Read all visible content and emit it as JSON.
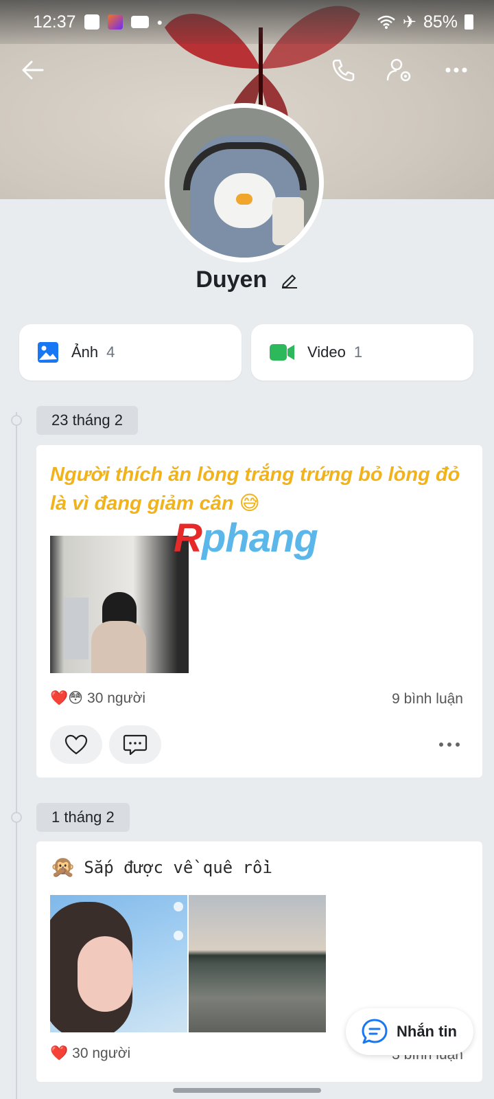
{
  "status_bar": {
    "time": "12:37",
    "battery": "85%",
    "icons": [
      "shopee-icon",
      "lazada-icon",
      "youtube-icon",
      "dot-icon",
      "wifi-icon",
      "airplane-icon",
      "battery-icon"
    ]
  },
  "header": {
    "icons": [
      "back-arrow-icon",
      "phone-call-icon",
      "profile-settings-icon",
      "more-icon"
    ]
  },
  "profile": {
    "name": "Duyen"
  },
  "media": {
    "photos_label": "Ảnh",
    "photos_count": "4",
    "videos_label": "Video",
    "videos_count": "1"
  },
  "posts": [
    {
      "date": "23 tháng 2",
      "text": "Người thích ăn lòng trắng trứng bỏ lòng đỏ là vì đang giảm cân 😅",
      "reaction_emojis": "❤️😳",
      "reactions_count": "30 người",
      "comments": "9 bình luận"
    },
    {
      "date": "1 tháng 2",
      "emoji": "🙊",
      "text": "Sắp được về quê rồi",
      "reaction_emojis": "❤️",
      "reactions_count": "30 người",
      "comments": "3 bình luận"
    }
  ],
  "watermark": {
    "first": "R",
    "rest": "phang"
  },
  "fab": {
    "label": "Nhắn tin"
  },
  "colors": {
    "accent_blue": "#1877f2",
    "video_green": "#2eb85c",
    "post_text_yellow": "#f2b21a"
  }
}
